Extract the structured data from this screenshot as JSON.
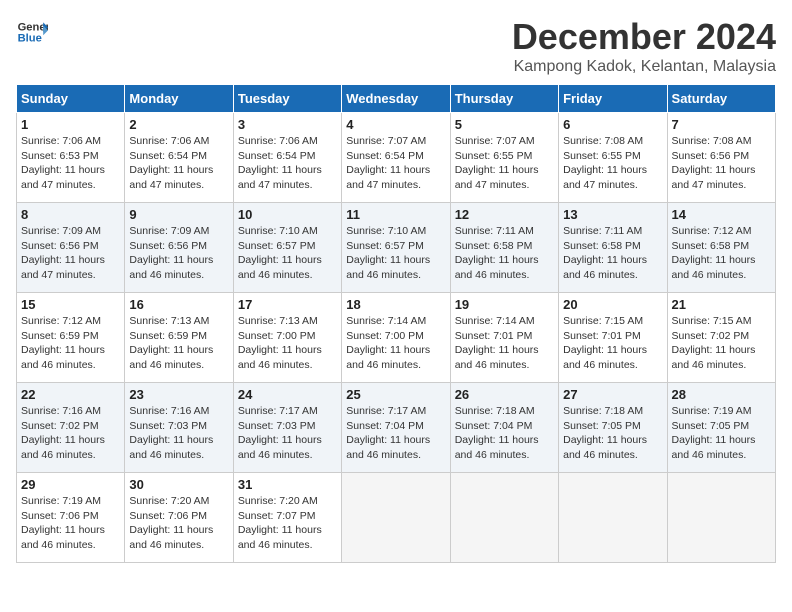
{
  "header": {
    "logo_line1": "General",
    "logo_line2": "Blue",
    "month": "December 2024",
    "location": "Kampong Kadok, Kelantan, Malaysia"
  },
  "weekdays": [
    "Sunday",
    "Monday",
    "Tuesday",
    "Wednesday",
    "Thursday",
    "Friday",
    "Saturday"
  ],
  "weeks": [
    [
      {
        "day": "1",
        "info": "Sunrise: 7:06 AM\nSunset: 6:53 PM\nDaylight: 11 hours\nand 47 minutes."
      },
      {
        "day": "2",
        "info": "Sunrise: 7:06 AM\nSunset: 6:54 PM\nDaylight: 11 hours\nand 47 minutes."
      },
      {
        "day": "3",
        "info": "Sunrise: 7:06 AM\nSunset: 6:54 PM\nDaylight: 11 hours\nand 47 minutes."
      },
      {
        "day": "4",
        "info": "Sunrise: 7:07 AM\nSunset: 6:54 PM\nDaylight: 11 hours\nand 47 minutes."
      },
      {
        "day": "5",
        "info": "Sunrise: 7:07 AM\nSunset: 6:55 PM\nDaylight: 11 hours\nand 47 minutes."
      },
      {
        "day": "6",
        "info": "Sunrise: 7:08 AM\nSunset: 6:55 PM\nDaylight: 11 hours\nand 47 minutes."
      },
      {
        "day": "7",
        "info": "Sunrise: 7:08 AM\nSunset: 6:56 PM\nDaylight: 11 hours\nand 47 minutes."
      }
    ],
    [
      {
        "day": "8",
        "info": "Sunrise: 7:09 AM\nSunset: 6:56 PM\nDaylight: 11 hours\nand 47 minutes."
      },
      {
        "day": "9",
        "info": "Sunrise: 7:09 AM\nSunset: 6:56 PM\nDaylight: 11 hours\nand 46 minutes."
      },
      {
        "day": "10",
        "info": "Sunrise: 7:10 AM\nSunset: 6:57 PM\nDaylight: 11 hours\nand 46 minutes."
      },
      {
        "day": "11",
        "info": "Sunrise: 7:10 AM\nSunset: 6:57 PM\nDaylight: 11 hours\nand 46 minutes."
      },
      {
        "day": "12",
        "info": "Sunrise: 7:11 AM\nSunset: 6:58 PM\nDaylight: 11 hours\nand 46 minutes."
      },
      {
        "day": "13",
        "info": "Sunrise: 7:11 AM\nSunset: 6:58 PM\nDaylight: 11 hours\nand 46 minutes."
      },
      {
        "day": "14",
        "info": "Sunrise: 7:12 AM\nSunset: 6:58 PM\nDaylight: 11 hours\nand 46 minutes."
      }
    ],
    [
      {
        "day": "15",
        "info": "Sunrise: 7:12 AM\nSunset: 6:59 PM\nDaylight: 11 hours\nand 46 minutes."
      },
      {
        "day": "16",
        "info": "Sunrise: 7:13 AM\nSunset: 6:59 PM\nDaylight: 11 hours\nand 46 minutes."
      },
      {
        "day": "17",
        "info": "Sunrise: 7:13 AM\nSunset: 7:00 PM\nDaylight: 11 hours\nand 46 minutes."
      },
      {
        "day": "18",
        "info": "Sunrise: 7:14 AM\nSunset: 7:00 PM\nDaylight: 11 hours\nand 46 minutes."
      },
      {
        "day": "19",
        "info": "Sunrise: 7:14 AM\nSunset: 7:01 PM\nDaylight: 11 hours\nand 46 minutes."
      },
      {
        "day": "20",
        "info": "Sunrise: 7:15 AM\nSunset: 7:01 PM\nDaylight: 11 hours\nand 46 minutes."
      },
      {
        "day": "21",
        "info": "Sunrise: 7:15 AM\nSunset: 7:02 PM\nDaylight: 11 hours\nand 46 minutes."
      }
    ],
    [
      {
        "day": "22",
        "info": "Sunrise: 7:16 AM\nSunset: 7:02 PM\nDaylight: 11 hours\nand 46 minutes."
      },
      {
        "day": "23",
        "info": "Sunrise: 7:16 AM\nSunset: 7:03 PM\nDaylight: 11 hours\nand 46 minutes."
      },
      {
        "day": "24",
        "info": "Sunrise: 7:17 AM\nSunset: 7:03 PM\nDaylight: 11 hours\nand 46 minutes."
      },
      {
        "day": "25",
        "info": "Sunrise: 7:17 AM\nSunset: 7:04 PM\nDaylight: 11 hours\nand 46 minutes."
      },
      {
        "day": "26",
        "info": "Sunrise: 7:18 AM\nSunset: 7:04 PM\nDaylight: 11 hours\nand 46 minutes."
      },
      {
        "day": "27",
        "info": "Sunrise: 7:18 AM\nSunset: 7:05 PM\nDaylight: 11 hours\nand 46 minutes."
      },
      {
        "day": "28",
        "info": "Sunrise: 7:19 AM\nSunset: 7:05 PM\nDaylight: 11 hours\nand 46 minutes."
      }
    ],
    [
      {
        "day": "29",
        "info": "Sunrise: 7:19 AM\nSunset: 7:06 PM\nDaylight: 11 hours\nand 46 minutes."
      },
      {
        "day": "30",
        "info": "Sunrise: 7:20 AM\nSunset: 7:06 PM\nDaylight: 11 hours\nand 46 minutes."
      },
      {
        "day": "31",
        "info": "Sunrise: 7:20 AM\nSunset: 7:07 PM\nDaylight: 11 hours\nand 46 minutes."
      },
      null,
      null,
      null,
      null
    ]
  ]
}
